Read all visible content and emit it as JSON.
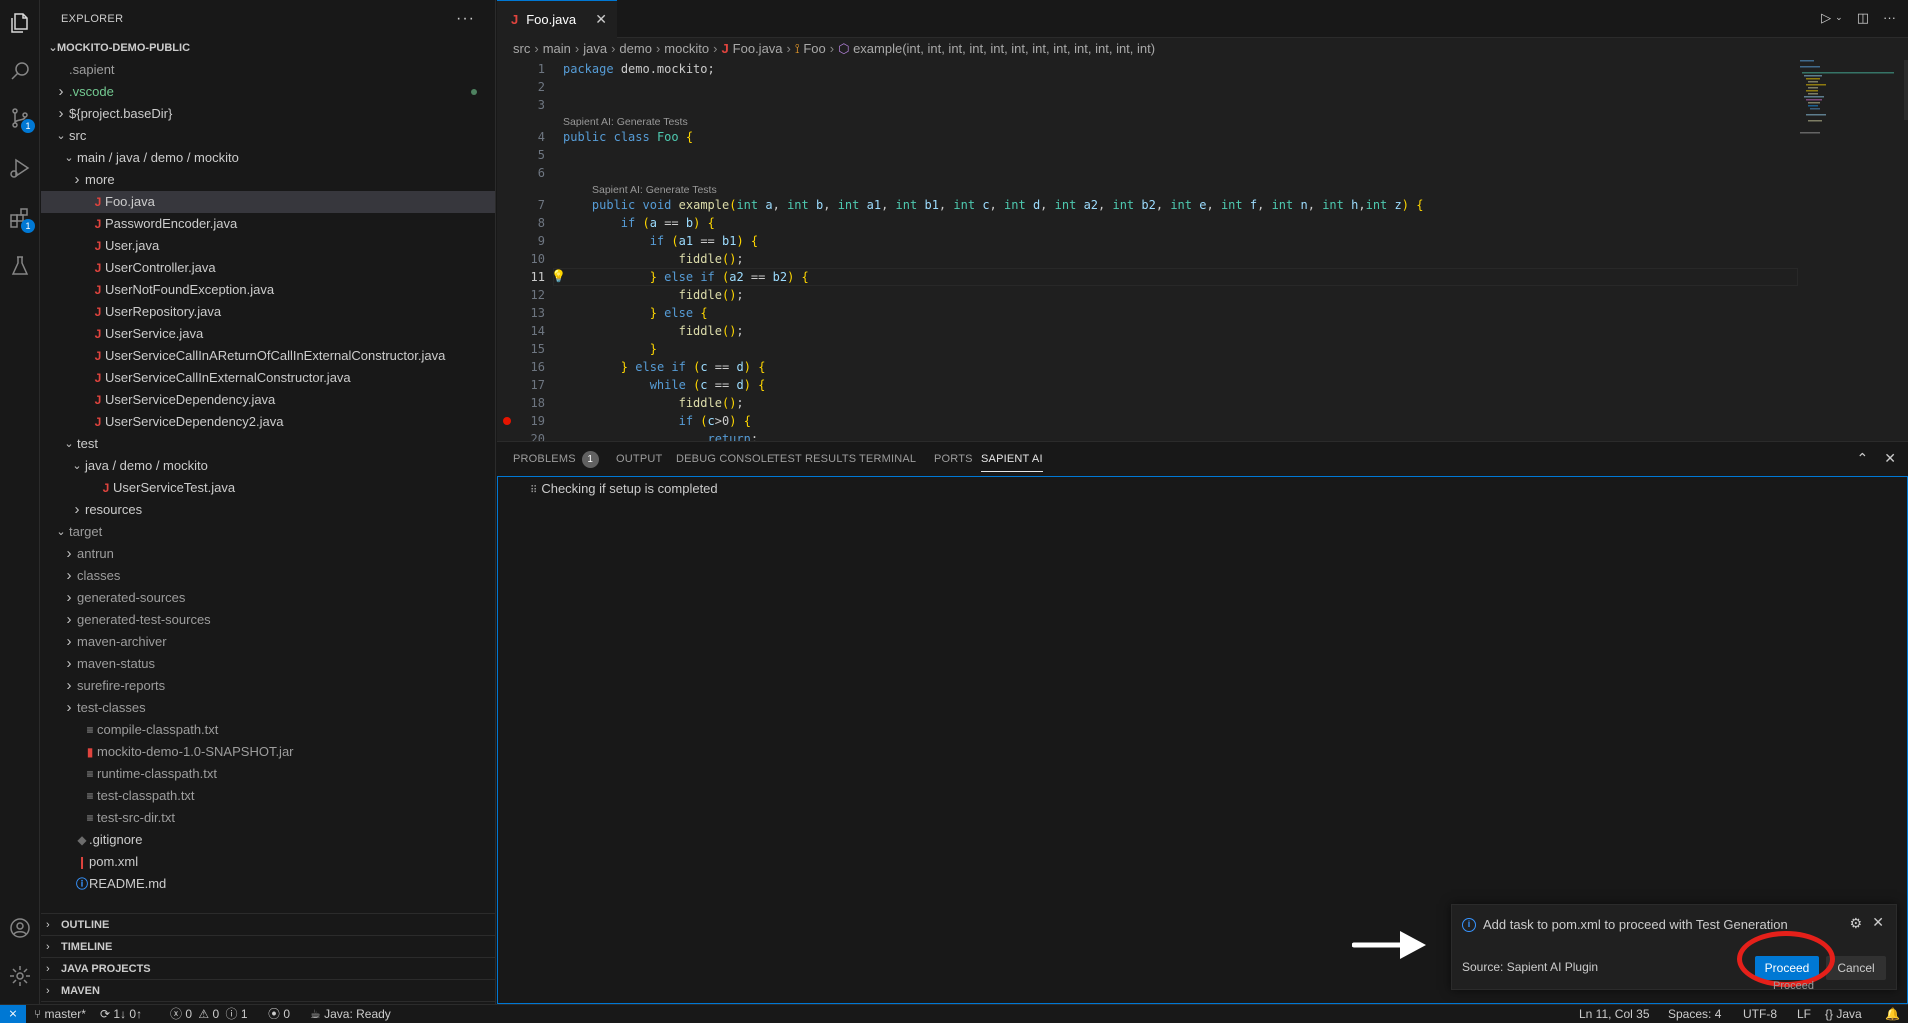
{
  "sidebar": {
    "title": "EXPLORER",
    "more": "···",
    "tree": [
      {
        "label": "MOCKITO-DEMO-PUBLIC",
        "level": 0,
        "chev": "open",
        "root": true
      },
      {
        "label": ".sapient",
        "level": 1,
        "icon": "none",
        "dim": true
      },
      {
        "label": ".vscode",
        "level": 1,
        "chev": "closed",
        "green": true,
        "dot": true
      },
      {
        "label": "${project.baseDir}",
        "level": 1,
        "chev": "closed"
      },
      {
        "label": "src",
        "level": 1,
        "chev": "open"
      },
      {
        "label": "main / java / demo / mockito",
        "level": 2,
        "chev": "open"
      },
      {
        "label": "more",
        "level": 3,
        "chev": "closed"
      },
      {
        "label": "Foo.java",
        "level": 3,
        "icon": "java",
        "selected": true
      },
      {
        "label": "PasswordEncoder.java",
        "level": 3,
        "icon": "java"
      },
      {
        "label": "User.java",
        "level": 3,
        "icon": "java"
      },
      {
        "label": "UserController.java",
        "level": 3,
        "icon": "java"
      },
      {
        "label": "UserNotFoundException.java",
        "level": 3,
        "icon": "java"
      },
      {
        "label": "UserRepository.java",
        "level": 3,
        "icon": "java"
      },
      {
        "label": "UserService.java",
        "level": 3,
        "icon": "java"
      },
      {
        "label": "UserServiceCallInAReturnOfCallInExternalConstructor.java",
        "level": 3,
        "icon": "java"
      },
      {
        "label": "UserServiceCallInExternalConstructor.java",
        "level": 3,
        "icon": "java"
      },
      {
        "label": "UserServiceDependency.java",
        "level": 3,
        "icon": "java"
      },
      {
        "label": "UserServiceDependency2.java",
        "level": 3,
        "icon": "java"
      },
      {
        "label": "test",
        "level": 2,
        "chev": "open"
      },
      {
        "label": "java / demo / mockito",
        "level": 3,
        "chev": "open",
        "sub": true
      },
      {
        "label": "UserServiceTest.java",
        "level": 4,
        "icon": "java"
      },
      {
        "label": "resources",
        "level": 3,
        "chev": "closed"
      },
      {
        "label": "target",
        "level": 1,
        "chev": "open",
        "dim": true
      },
      {
        "label": "antrun",
        "level": 2,
        "chev": "closed",
        "dim": true
      },
      {
        "label": "classes",
        "level": 2,
        "chev": "closed",
        "dim": true
      },
      {
        "label": "generated-sources",
        "level": 2,
        "chev": "closed",
        "dim": true
      },
      {
        "label": "generated-test-sources",
        "level": 2,
        "chev": "closed",
        "dim": true
      },
      {
        "label": "maven-archiver",
        "level": 2,
        "chev": "closed",
        "dim": true
      },
      {
        "label": "maven-status",
        "level": 2,
        "chev": "closed",
        "dim": true
      },
      {
        "label": "surefire-reports",
        "level": 2,
        "chev": "closed",
        "dim": true
      },
      {
        "label": "test-classes",
        "level": 2,
        "chev": "closed",
        "dim": true
      },
      {
        "label": "compile-classpath.txt",
        "level": 2,
        "icon": "txt",
        "dim": true
      },
      {
        "label": "mockito-demo-1.0-SNAPSHOT.jar",
        "level": 2,
        "icon": "jar",
        "dim": true
      },
      {
        "label": "runtime-classpath.txt",
        "level": 2,
        "icon": "txt",
        "dim": true
      },
      {
        "label": "test-classpath.txt",
        "level": 2,
        "icon": "txt",
        "dim": true
      },
      {
        "label": "test-src-dir.txt",
        "level": 2,
        "icon": "txt",
        "dim": true
      },
      {
        "label": ".gitignore",
        "level": 1,
        "icon": "git"
      },
      {
        "label": "pom.xml",
        "level": 1,
        "icon": "pom"
      },
      {
        "label": "README.md",
        "level": 1,
        "icon": "info"
      }
    ],
    "sections": [
      "OUTLINE",
      "TIMELINE",
      "JAVA PROJECTS",
      "MAVEN"
    ]
  },
  "activity": {
    "scm_badge": "1",
    "ext_badge": "1"
  },
  "editor": {
    "tab": {
      "label": "Foo.java",
      "icon": "J"
    },
    "breadcrumb": {
      "parts": [
        "src",
        "main",
        "java",
        "demo",
        "mockito"
      ],
      "file": "Foo.java",
      "cls": "Foo",
      "method": "example(int, int, int, int, int, int, int, int, int, int, int, int)"
    },
    "lenses": [
      {
        "text": "Sapient AI: Generate Tests",
        "before_line": 4,
        "indent": 0
      },
      {
        "text": "Sapient AI: Generate Tests",
        "before_line": 7,
        "indent": 1
      }
    ],
    "code": [
      {
        "n": "1",
        "t": "package demo.mockito;"
      },
      {
        "n": "2",
        "t": ""
      },
      {
        "n": "3",
        "t": ""
      },
      {
        "n": "4",
        "t": "public class Foo {"
      },
      {
        "n": "5",
        "t": ""
      },
      {
        "n": "6",
        "t": ""
      },
      {
        "n": "7",
        "t": "    public void example(int a, int b, int a1, int b1, int c, int d, int a2, int b2, int e, int f, int n, int h,int z) {"
      },
      {
        "n": "8",
        "t": "        if (a == b) {"
      },
      {
        "n": "9",
        "t": "            if (a1 == b1) {"
      },
      {
        "n": "10",
        "t": "                fiddle();"
      },
      {
        "n": "11",
        "t": "            } else if (a2 == b2) {"
      },
      {
        "n": "12",
        "t": "                fiddle();"
      },
      {
        "n": "13",
        "t": "            } else {"
      },
      {
        "n": "14",
        "t": "                fiddle();"
      },
      {
        "n": "15",
        "t": "            }"
      },
      {
        "n": "16",
        "t": "        } else if (c == d) {"
      },
      {
        "n": "17",
        "t": "            while (c == d) {"
      },
      {
        "n": "18",
        "t": "                fiddle();"
      },
      {
        "n": "19",
        "t": "                if (c>0) {"
      },
      {
        "n": "20",
        "t": "                    return;"
      }
    ],
    "current_line": 11,
    "breakpoint_line": 19,
    "bulb_line": 11
  },
  "panel": {
    "tabs": [
      {
        "label": "PROBLEMS",
        "badge": "1"
      },
      {
        "label": "OUTPUT"
      },
      {
        "label": "DEBUG CONSOLE"
      },
      {
        "label": "TEST RESULTS"
      },
      {
        "label": "TERMINAL"
      },
      {
        "label": "PORTS"
      },
      {
        "label": "SAPIENT AI",
        "active": true
      }
    ],
    "status": "Checking if setup is completed"
  },
  "notification": {
    "message": "Add task to pom.xml to proceed with Test Generation",
    "source": "Source: Sapient AI Plugin",
    "proceed": "Proceed",
    "cancel": "Cancel",
    "ghost": "Proceed"
  },
  "statusbar": {
    "branch": "master*",
    "sync": "1↓ 0↑",
    "errors": "0",
    "warnings": "0",
    "info": "1",
    "ports": "0",
    "java": "Java: Ready",
    "position": "Ln 11, Col 35",
    "spaces": "Spaces: 4",
    "encoding": "UTF-8",
    "eol": "LF",
    "language": "Java"
  },
  "colors": {
    "accent": "#0078d4",
    "highlight_ring": "#e5201a",
    "java_icon": "#e0443e"
  }
}
